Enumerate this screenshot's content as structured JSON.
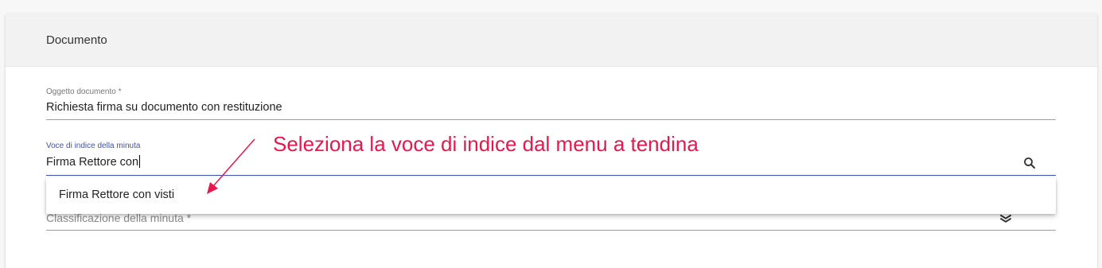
{
  "section": {
    "title": "Documento"
  },
  "fields": {
    "oggetto": {
      "label": "Oggetto documento *",
      "value": "Richiesta firma su documento con restituzione"
    },
    "voce_indice": {
      "label": "Voce di indice della minuta",
      "value": "Firma Rettore con",
      "icon": "search-icon"
    },
    "classificazione": {
      "label": "Classificazione della minuta *",
      "icon": "layers-icon"
    }
  },
  "dropdown": {
    "options": [
      "Firma Rettore con visti"
    ]
  },
  "annotation": {
    "text": "Seleziona la voce di indice dal menu a tendina",
    "color": "#e8174e"
  },
  "colors": {
    "accent": "#3f51b5",
    "annotation": "#e8174e",
    "header_bg": "#f2f2f2"
  }
}
